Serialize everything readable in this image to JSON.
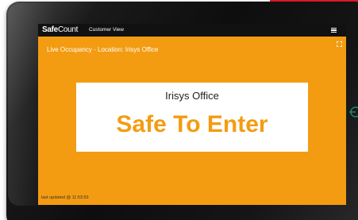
{
  "header": {
    "brand_bold": "Safe",
    "brand_regular": "Count",
    "view_label": "Customer View"
  },
  "main": {
    "location_heading": "Live Occupancy - Location: Irisys Office",
    "card": {
      "location_name": "Irisys Office",
      "status_text": "Safe To Enter"
    },
    "last_updated": "last updated @ 11:53:53"
  },
  "icons": {
    "menu": "hamburger-menu-icon",
    "fullscreen": "expand-icon",
    "edge": "power-icon"
  },
  "colors": {
    "status_amber": "#f39c12",
    "topbar": "#111111",
    "accent_red": "#e31b2a",
    "edge_icon": "#1aa37a"
  }
}
